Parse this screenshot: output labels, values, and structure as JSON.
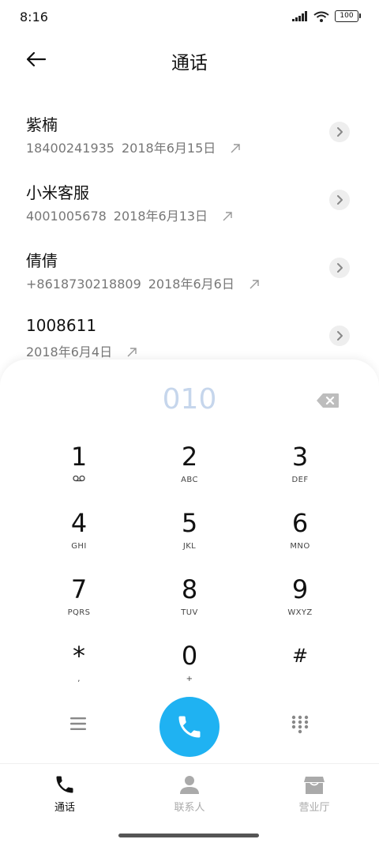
{
  "status_bar": {
    "time": "8:16",
    "battery": "100"
  },
  "header": {
    "title": "通话"
  },
  "calls": [
    {
      "name": "紫楠",
      "number": "18400241935",
      "date": "2018年6月15日"
    },
    {
      "name": "小米客服",
      "number": "4001005678",
      "date": "2018年6月13日"
    },
    {
      "name": "倩倩",
      "number": "+8618730218809",
      "date": "2018年6月6日"
    },
    {
      "name": "1008611",
      "number": "",
      "date": "2018年6月4日"
    }
  ],
  "dialpad": {
    "input_value": "010",
    "keys": [
      {
        "digit": "1",
        "letters": ""
      },
      {
        "digit": "2",
        "letters": "ABC"
      },
      {
        "digit": "3",
        "letters": "DEF"
      },
      {
        "digit": "4",
        "letters": "GHI"
      },
      {
        "digit": "5",
        "letters": "JKL"
      },
      {
        "digit": "6",
        "letters": "MNO"
      },
      {
        "digit": "7",
        "letters": "PQRS"
      },
      {
        "digit": "8",
        "letters": "TUV"
      },
      {
        "digit": "9",
        "letters": "WXYZ"
      },
      {
        "digit": "*",
        "letters": ","
      },
      {
        "digit": "0",
        "letters": "+"
      },
      {
        "digit": "#",
        "letters": ""
      }
    ]
  },
  "bottom_nav": {
    "tabs": [
      {
        "label": "通话",
        "icon": "phone-icon",
        "active": true
      },
      {
        "label": "联系人",
        "icon": "person-icon",
        "active": false
      },
      {
        "label": "营业厅",
        "icon": "store-icon",
        "active": false
      }
    ]
  },
  "colors": {
    "accent": "#1fb2f2",
    "dial_input_text": "#c6d6ec",
    "nav_active": "#111111",
    "nav_inactive": "#aaaaaa"
  }
}
